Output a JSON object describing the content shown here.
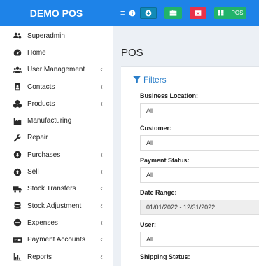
{
  "brand": "DEMO POS",
  "sidebar": {
    "items": [
      {
        "label": "Superadmin",
        "icon": "users-cog-icon",
        "chevron": ""
      },
      {
        "label": "Home",
        "icon": "dashboard-icon",
        "chevron": ""
      },
      {
        "label": "User Management",
        "icon": "users-icon",
        "chevron": "‹"
      },
      {
        "label": "Contacts",
        "icon": "address-book-icon",
        "chevron": "‹"
      },
      {
        "label": "Products",
        "icon": "cubes-icon",
        "chevron": "‹"
      },
      {
        "label": "Manufacturing",
        "icon": "industry-icon",
        "chevron": ""
      },
      {
        "label": "Repair",
        "icon": "wrench-icon",
        "chevron": ""
      },
      {
        "label": "Purchases",
        "icon": "arrow-circle-down-icon",
        "chevron": "‹"
      },
      {
        "label": "Sell",
        "icon": "arrow-circle-up-icon",
        "chevron": "‹"
      },
      {
        "label": "Stock Transfers",
        "icon": "truck-icon",
        "chevron": "‹"
      },
      {
        "label": "Stock Adjustment",
        "icon": "database-icon",
        "chevron": "‹"
      },
      {
        "label": "Expenses",
        "icon": "minus-circle-icon",
        "chevron": "‹"
      },
      {
        "label": "Payment Accounts",
        "icon": "money-check-icon",
        "chevron": "‹"
      },
      {
        "label": "Reports",
        "icon": "bar-chart-icon",
        "chevron": "‹"
      }
    ]
  },
  "topbar": {
    "menu_icon": "≡",
    "pos_label": "POS"
  },
  "page": {
    "title": "POS"
  },
  "filters": {
    "heading": "Filters",
    "fields": [
      {
        "label": "Business Location:",
        "value": "All"
      },
      {
        "label": "Customer:",
        "value": "All"
      },
      {
        "label": "Payment Status:",
        "value": "All"
      },
      {
        "label": "Date Range:",
        "value": "01/01/2022 - 12/31/2022"
      },
      {
        "label": "User:",
        "value": "All"
      },
      {
        "label": "Shipping Status:",
        "value": ""
      }
    ]
  },
  "colors": {
    "primary": "#1e83e8",
    "green": "#21b36a",
    "red": "#e9324a",
    "teal": "#128ab6"
  }
}
